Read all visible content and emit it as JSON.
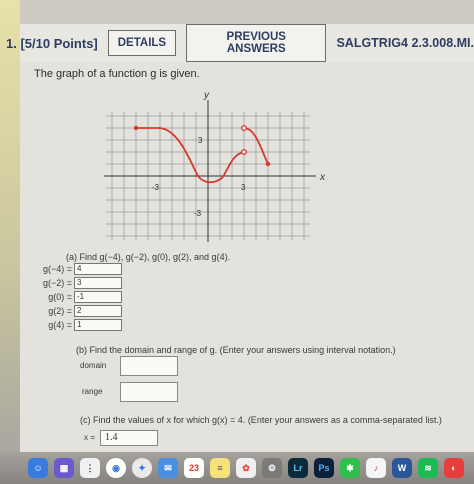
{
  "header": {
    "question_label": "1. [5/10 Points]",
    "details_button": "DETAILS",
    "previous_answers_button": "PREVIOUS ANSWERS",
    "question_code": "SALGTRIG4 2.3.008.MI."
  },
  "prompt": "The graph of a function g is given.",
  "graph": {
    "x_axis_label": "x",
    "y_axis_label": "y",
    "tick_labels": {
      "x_neg": "-3",
      "x_pos": "3",
      "y_pos": "3",
      "y_neg": "-3"
    },
    "curve_color": "#d23a2e"
  },
  "part_a": {
    "instruction": "(a) Find g(−4), g(−2), g(0), g(2), and g(4).",
    "rows": [
      {
        "label": "g(−4) =",
        "value": "4"
      },
      {
        "label": "g(−2) =",
        "value": "3"
      },
      {
        "label": "g(0) =",
        "value": "-1"
      },
      {
        "label": "g(2) =",
        "value": "2"
      },
      {
        "label": "g(4) =",
        "value": "1"
      }
    ]
  },
  "part_b": {
    "instruction": "(b) Find the domain and range of g. (Enter your answers using interval notation.)",
    "domain_label": "domain",
    "range_label": "range"
  },
  "part_c": {
    "instruction": "(c) Find the values of x for which g(x) = 4. (Enter your answers as a comma-separated list.)",
    "x_label": "x =",
    "x_value": "1.4"
  },
  "dock": {
    "calendar_day": "23",
    "lightroom": "Lr",
    "photoshop": "Ps",
    "word": "W"
  }
}
